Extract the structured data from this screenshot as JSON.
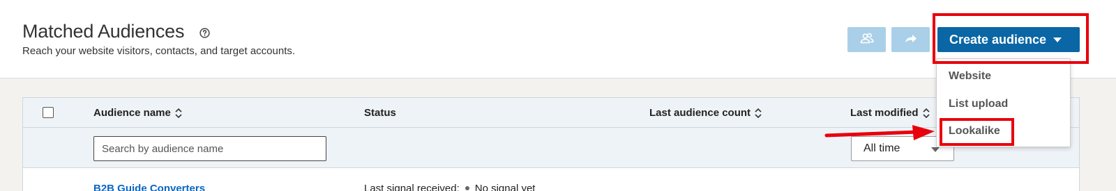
{
  "header": {
    "title": "Matched Audiences",
    "subtitle": "Reach your website visitors, contacts, and target accounts.",
    "help_icon": "question-circle-icon",
    "create_button_label": "Create audience",
    "people_icon": "people-icon",
    "share_icon": "share-arrow-icon"
  },
  "table": {
    "columns": [
      "Audience name",
      "Status",
      "Last audience count",
      "Last modified"
    ],
    "search_placeholder": "Search by audience name",
    "time_filter": "All time",
    "rows": [
      {
        "name": "B2B Guide Converters",
        "status_label": "Last signal received:",
        "status_value": "No signal yet"
      }
    ]
  },
  "dropdown": {
    "items": [
      "Website",
      "List upload",
      "Lookalike"
    ]
  },
  "colors": {
    "primary": "#0a66a4",
    "disabled_button": "#a9d0e8",
    "link": "#0a66c2",
    "annotation": "#e8000c",
    "header_row": "#eef3f7"
  }
}
